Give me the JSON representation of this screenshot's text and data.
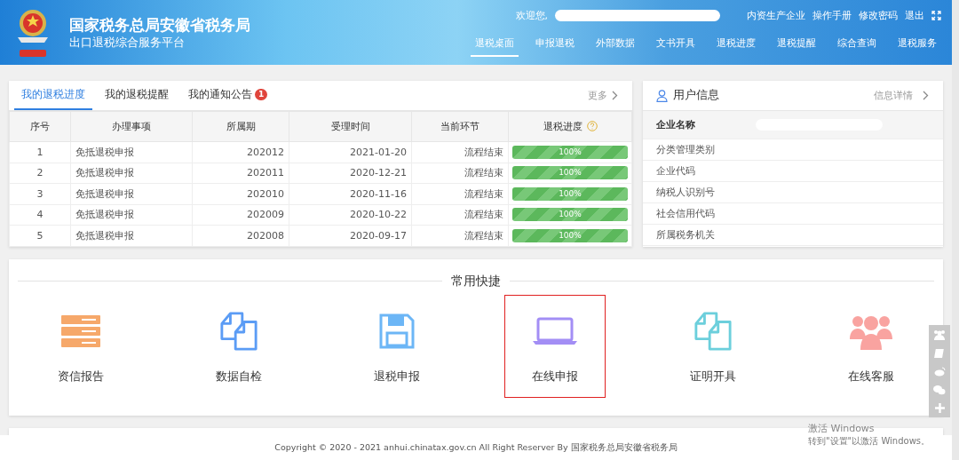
{
  "header": {
    "title": "国家税务总局安徽省税务局",
    "subtitle": "出口退税综合服务平台",
    "welcome": "欢迎您,",
    "top_links": [
      "内资生产企业",
      "操作手册",
      "修改密码",
      "退出"
    ],
    "nav": [
      {
        "label": "退税桌面",
        "selected": true
      },
      {
        "label": "申报退税",
        "selected": false
      },
      {
        "label": "外部数据",
        "selected": false
      },
      {
        "label": "文书开具",
        "selected": false
      },
      {
        "label": "退税进度",
        "selected": false
      },
      {
        "label": "退税提醒",
        "selected": false
      },
      {
        "label": "综合查询",
        "selected": false
      },
      {
        "label": "退税服务",
        "selected": false
      }
    ]
  },
  "progress_panel": {
    "tabs": [
      {
        "label": "我的退税进度",
        "selected": true
      },
      {
        "label": "我的退税提醒",
        "selected": false
      },
      {
        "label": "我的通知公告",
        "selected": false,
        "badge": "1"
      }
    ],
    "more": "更多",
    "columns": [
      "序号",
      "办理事项",
      "所属期",
      "受理时间",
      "当前环节",
      "退税进度"
    ],
    "rows": [
      {
        "no": "1",
        "item": "免抵退税申报",
        "period": "202012",
        "date": "2021-01-20",
        "stage": "流程结束",
        "level": 1,
        "reading": "100%"
      },
      {
        "no": "2",
        "item": "免抵退税申报",
        "period": "202011",
        "date": "2020-12-21",
        "stage": "流程结束",
        "level": 1,
        "reading": "100%"
      },
      {
        "no": "3",
        "item": "免抵退税申报",
        "period": "202010",
        "date": "2020-11-16",
        "stage": "流程结束",
        "level": 1,
        "reading": "100%"
      },
      {
        "no": "4",
        "item": "免抵退税申报",
        "period": "202009",
        "date": "2020-10-22",
        "stage": "流程结束",
        "level": 1,
        "reading": "100%"
      },
      {
        "no": "5",
        "item": "免抵退税申报",
        "period": "202008",
        "date": "2020-09-17",
        "stage": "流程结束",
        "level": 1,
        "reading": "100%"
      }
    ]
  },
  "user_info": {
    "title": "用户信息",
    "details": "信息详情",
    "fields": [
      "企业名称",
      "分类管理类别",
      "企业代码",
      "纳税人识别号",
      "社会信用代码",
      "所属税务机关"
    ]
  },
  "shortcuts": {
    "title": "常用快捷",
    "items": [
      {
        "label": "资信报告",
        "kind": "report",
        "color": "#f6a86a",
        "highlighted": false
      },
      {
        "label": "数据自检",
        "kind": "docs",
        "color": "#5b9cf5",
        "highlighted": false
      },
      {
        "label": "退税申报",
        "kind": "disk",
        "color": "#6cb6f6",
        "highlighted": false
      },
      {
        "label": "在线申报",
        "kind": "laptop",
        "color": "#a38ef5",
        "highlighted": true
      },
      {
        "label": "证明开具",
        "kind": "docs",
        "color": "#6ccfdc",
        "highlighted": false
      },
      {
        "label": "在线客服",
        "kind": "people",
        "color": "#f9a3a0",
        "highlighted": false
      }
    ]
  },
  "footer": "Copyright © 2020 - 2021 anhui.chinatax.gov.cn All Right Reserver By 国家税务总局安徽省税务局",
  "activation": {
    "title": "激活 Windows",
    "hint": "转到\"设置\"以激活 Windows。"
  }
}
